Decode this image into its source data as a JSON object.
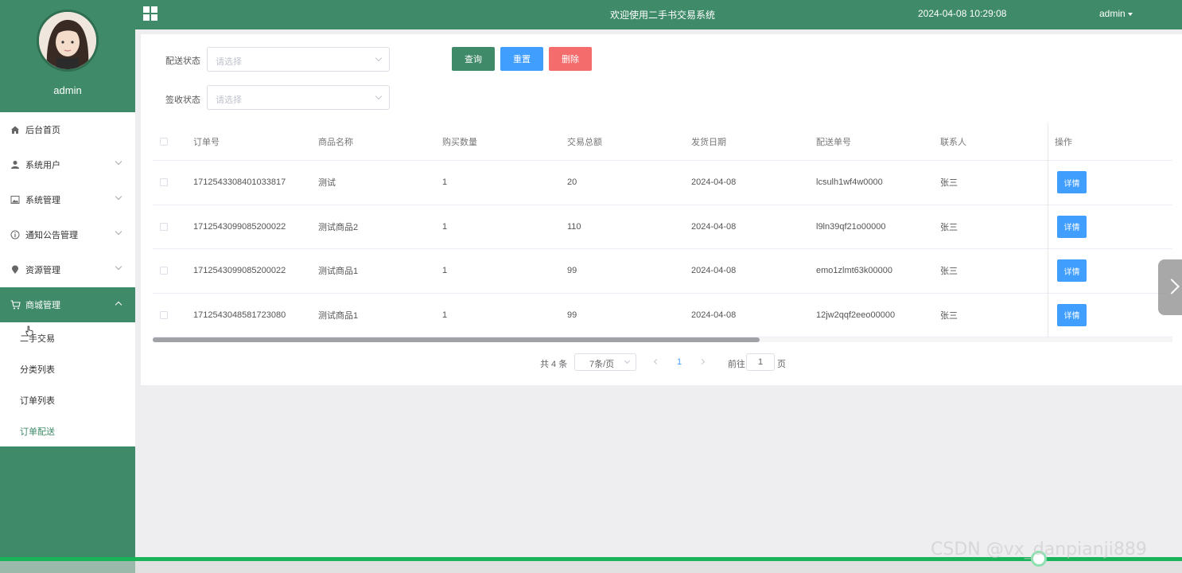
{
  "sidebar": {
    "username": "admin",
    "menu": [
      {
        "label": "后台首页",
        "icon": "home-icon",
        "expandable": false
      },
      {
        "label": "系统用户",
        "icon": "user-icon",
        "expandable": true
      },
      {
        "label": "系统管理",
        "icon": "image-icon",
        "expandable": true
      },
      {
        "label": "通知公告管理",
        "icon": "info-icon",
        "expandable": true
      },
      {
        "label": "资源管理",
        "icon": "location-icon",
        "expandable": true
      },
      {
        "label": "商城管理",
        "icon": "cart-icon",
        "expandable": true,
        "active": true
      }
    ],
    "submenu": [
      {
        "label": "二手交易"
      },
      {
        "label": "分类列表"
      },
      {
        "label": "订单列表"
      },
      {
        "label": "订单配送",
        "current": true
      }
    ]
  },
  "header": {
    "title": "欢迎使用二手书交易系统",
    "datetime": "2024-04-08 10:29:08",
    "user": "admin"
  },
  "filters": {
    "delivery_status_label": "配送状态",
    "delivery_status_placeholder": "请选择",
    "receipt_status_label": "签收状态",
    "receipt_status_placeholder": "请选择"
  },
  "actions": {
    "query": "查询",
    "reset": "重置",
    "delete": "删除"
  },
  "table": {
    "columns": [
      "订单号",
      "商品名称",
      "购买数量",
      "交易总额",
      "发货日期",
      "配送单号",
      "联系人",
      "操作"
    ],
    "rows": [
      {
        "order_no": "1712543308401033817",
        "product": "测试",
        "qty": "1",
        "total": "20",
        "ship_date": "2024-04-08",
        "delivery_no": "lcsulh1wf4w0000",
        "contact": "张三",
        "action": "详情"
      },
      {
        "order_no": "1712543099085200022",
        "product": "测试商品2",
        "qty": "1",
        "total": "110",
        "ship_date": "2024-04-08",
        "delivery_no": "l9ln39qf21o00000",
        "contact": "张三",
        "action": "详情"
      },
      {
        "order_no": "1712543099085200022",
        "product": "测试商品1",
        "qty": "1",
        "total": "99",
        "ship_date": "2024-04-08",
        "delivery_no": "emo1zlmt63k00000",
        "contact": "张三",
        "action": "详情"
      },
      {
        "order_no": "1712543048581723080",
        "product": "测试商品1",
        "qty": "1",
        "total": "99",
        "ship_date": "2024-04-08",
        "delivery_no": "12jw2qqf2eeo00000",
        "contact": "张三",
        "action": "详情"
      }
    ]
  },
  "pagination": {
    "total": "共 4 条",
    "page_size": "7条/页",
    "current_page": "1",
    "goto_label": "前往",
    "goto_value": "1",
    "page_suffix": "页"
  },
  "watermark": "CSDN @vx_danpianji889",
  "colors": {
    "primary": "#3f8a68",
    "blue": "#409eff",
    "red": "#f56c6c"
  }
}
